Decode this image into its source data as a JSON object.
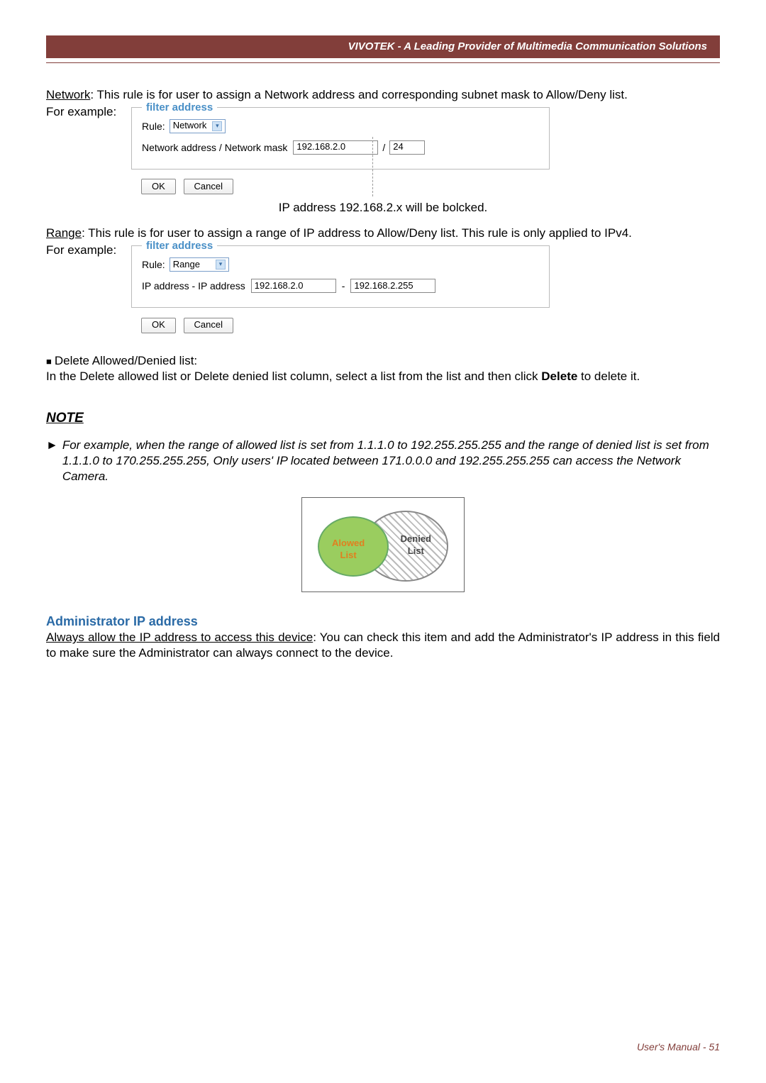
{
  "header": {
    "title": "VIVOTEK - A Leading Provider of Multimedia Communication Solutions"
  },
  "p1": {
    "label": "Network",
    "rest": ": This rule is for user to assign a Network address and corresponding subnet mask to Allow/Deny list."
  },
  "example_label": "For example:",
  "fs1": {
    "legend": "filter address",
    "rule_label": "Rule:",
    "rule_value": "Network",
    "line2_label": "Network address / Network mask",
    "addr": "192.168.2.0",
    "slash": "/",
    "mask": "24",
    "ok": "OK",
    "cancel": "Cancel"
  },
  "caption1": "IP address 192.168.2.x will be bolcked.",
  "p2": {
    "label": "Range",
    "rest": ": This rule is for user to assign a range of IP address to Allow/Deny list. This rule is only applied to IPv4."
  },
  "fs2": {
    "legend": "filter address",
    "rule_label": "Rule:",
    "rule_value": "Range",
    "line2_label": "IP address - IP address",
    "from": "192.168.2.0",
    "dash": "-",
    "to": "192.168.2.255",
    "ok": "OK",
    "cancel": "Cancel"
  },
  "p3": {
    "bullet": "■",
    "head": "Delete Allowed/Denied list:",
    "body_pre": "In the Delete allowed list or Delete denied list column, select a list from the list and then click ",
    "bold": "Delete",
    "body_post": " to delete it."
  },
  "note": {
    "head": "NOTE",
    "arrow": "►",
    "body": "For example, when the range of allowed list is set from 1.1.1.0 to 192.255.255.255 and the range of denied list is set from 1.1.1.0 to 170.255.255.255, Only users' IP located between 171.0.0.0 and 192.255.255.255 can access the Network Camera."
  },
  "venn": {
    "allowed_l1": "Alowed",
    "allowed_l2": "List",
    "denied_l1": "Denied",
    "denied_l2": "List"
  },
  "admin": {
    "head": "Administrator IP address",
    "u": "Always allow the IP address to access this device",
    "rest": ": You can check this item and add the Administrator's IP address in this field to make sure the Administrator can always connect to the device."
  },
  "footer": {
    "text": "User's Manual - 51"
  }
}
